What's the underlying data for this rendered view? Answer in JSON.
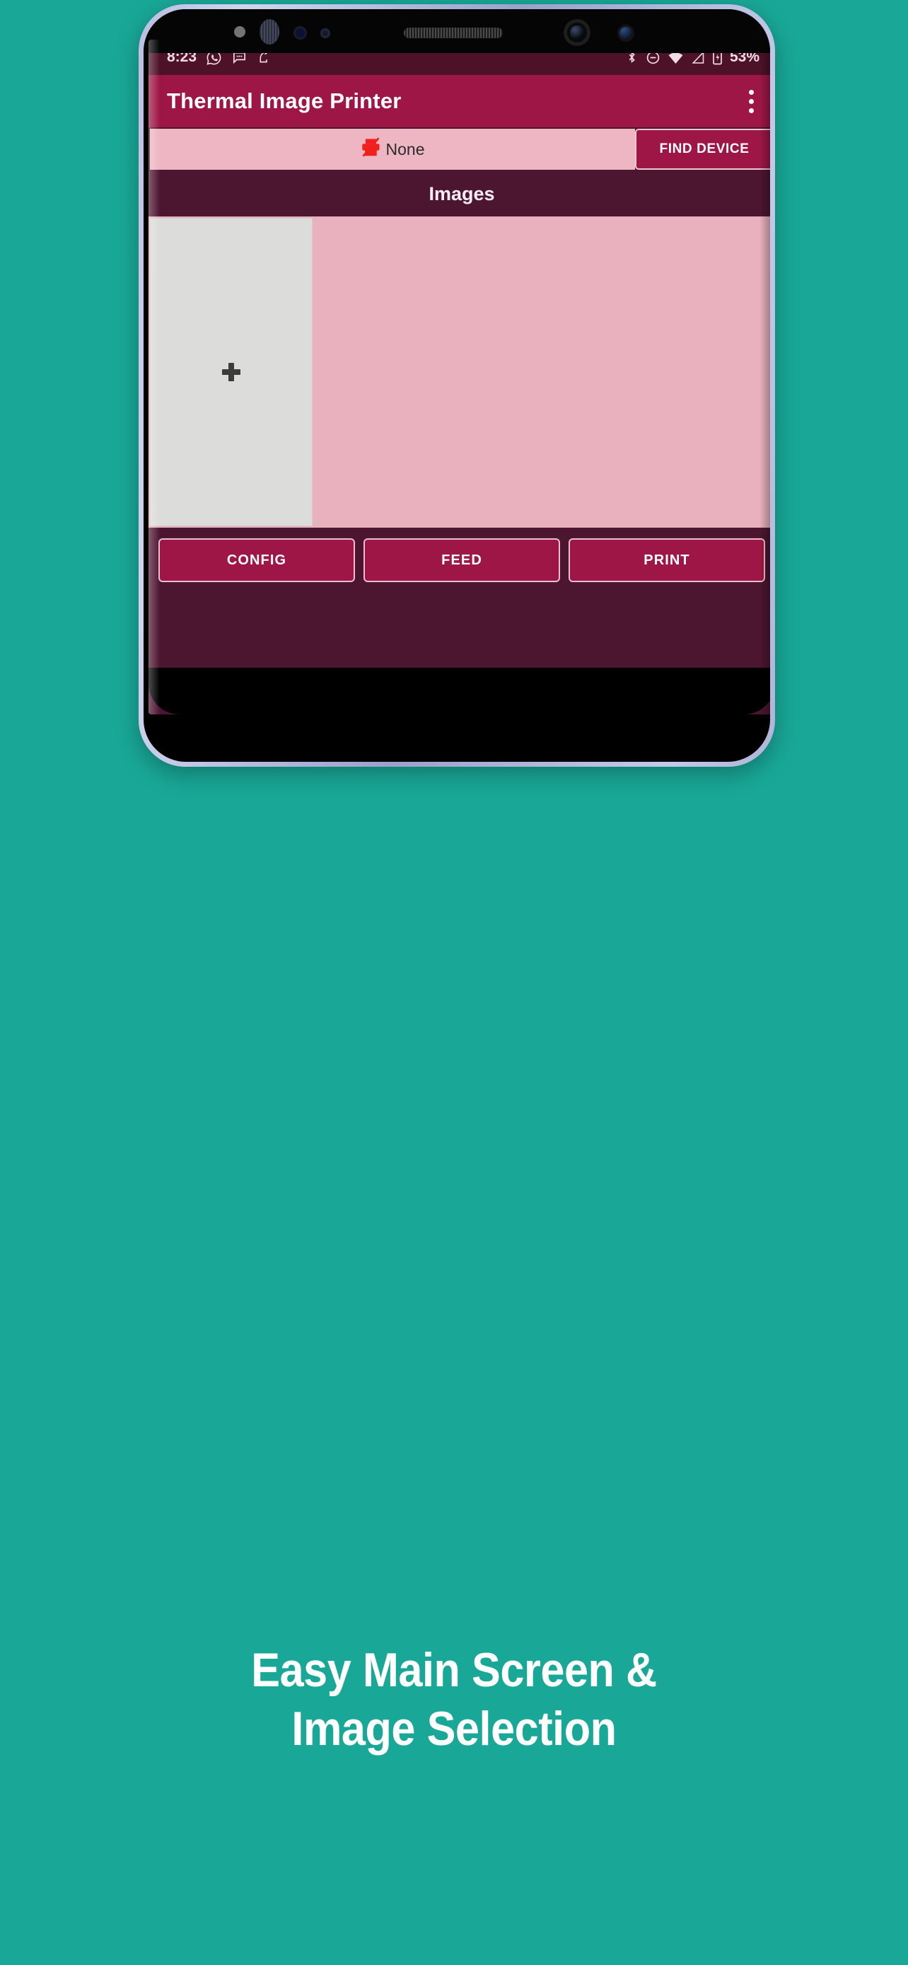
{
  "background_color": "#19a897",
  "status_bar": {
    "time": "8:23",
    "battery_percent": "53%",
    "left_icons": [
      "whatsapp-icon",
      "message-bubble-icon",
      "share-notification-icon"
    ],
    "right_icons": [
      "bluetooth-icon",
      "do-not-disturb-icon",
      "wifi-icon",
      "cellular-signal-icon",
      "battery-charging-icon"
    ]
  },
  "app_bar": {
    "title": "Thermal Image Printer",
    "overflow_menu": "more-options"
  },
  "device_row": {
    "selected_device": "None",
    "device_icon": "printer-off-icon",
    "find_device_label": "FIND DEVICE"
  },
  "images_section": {
    "header": "Images",
    "add_tile_icon": "plus-icon"
  },
  "actions": [
    {
      "label": "CONFIG",
      "name": "config-button"
    },
    {
      "label": "FEED",
      "name": "feed-button"
    },
    {
      "label": "PRINT",
      "name": "print-button"
    }
  ],
  "caption": {
    "line1": "Easy Main Screen &",
    "line2": "Image Selection"
  },
  "colors": {
    "teal_background": "#19a897",
    "app_bar": "#9e1646",
    "dark_maroon": "#4d1630",
    "status_bar": "#4d1227",
    "pink_panel": "#e9b0bd",
    "light_pink_chip": "#eeb6c3",
    "tile_gray": "#dcdcda",
    "printer_icon_red": "#f21f1f"
  }
}
